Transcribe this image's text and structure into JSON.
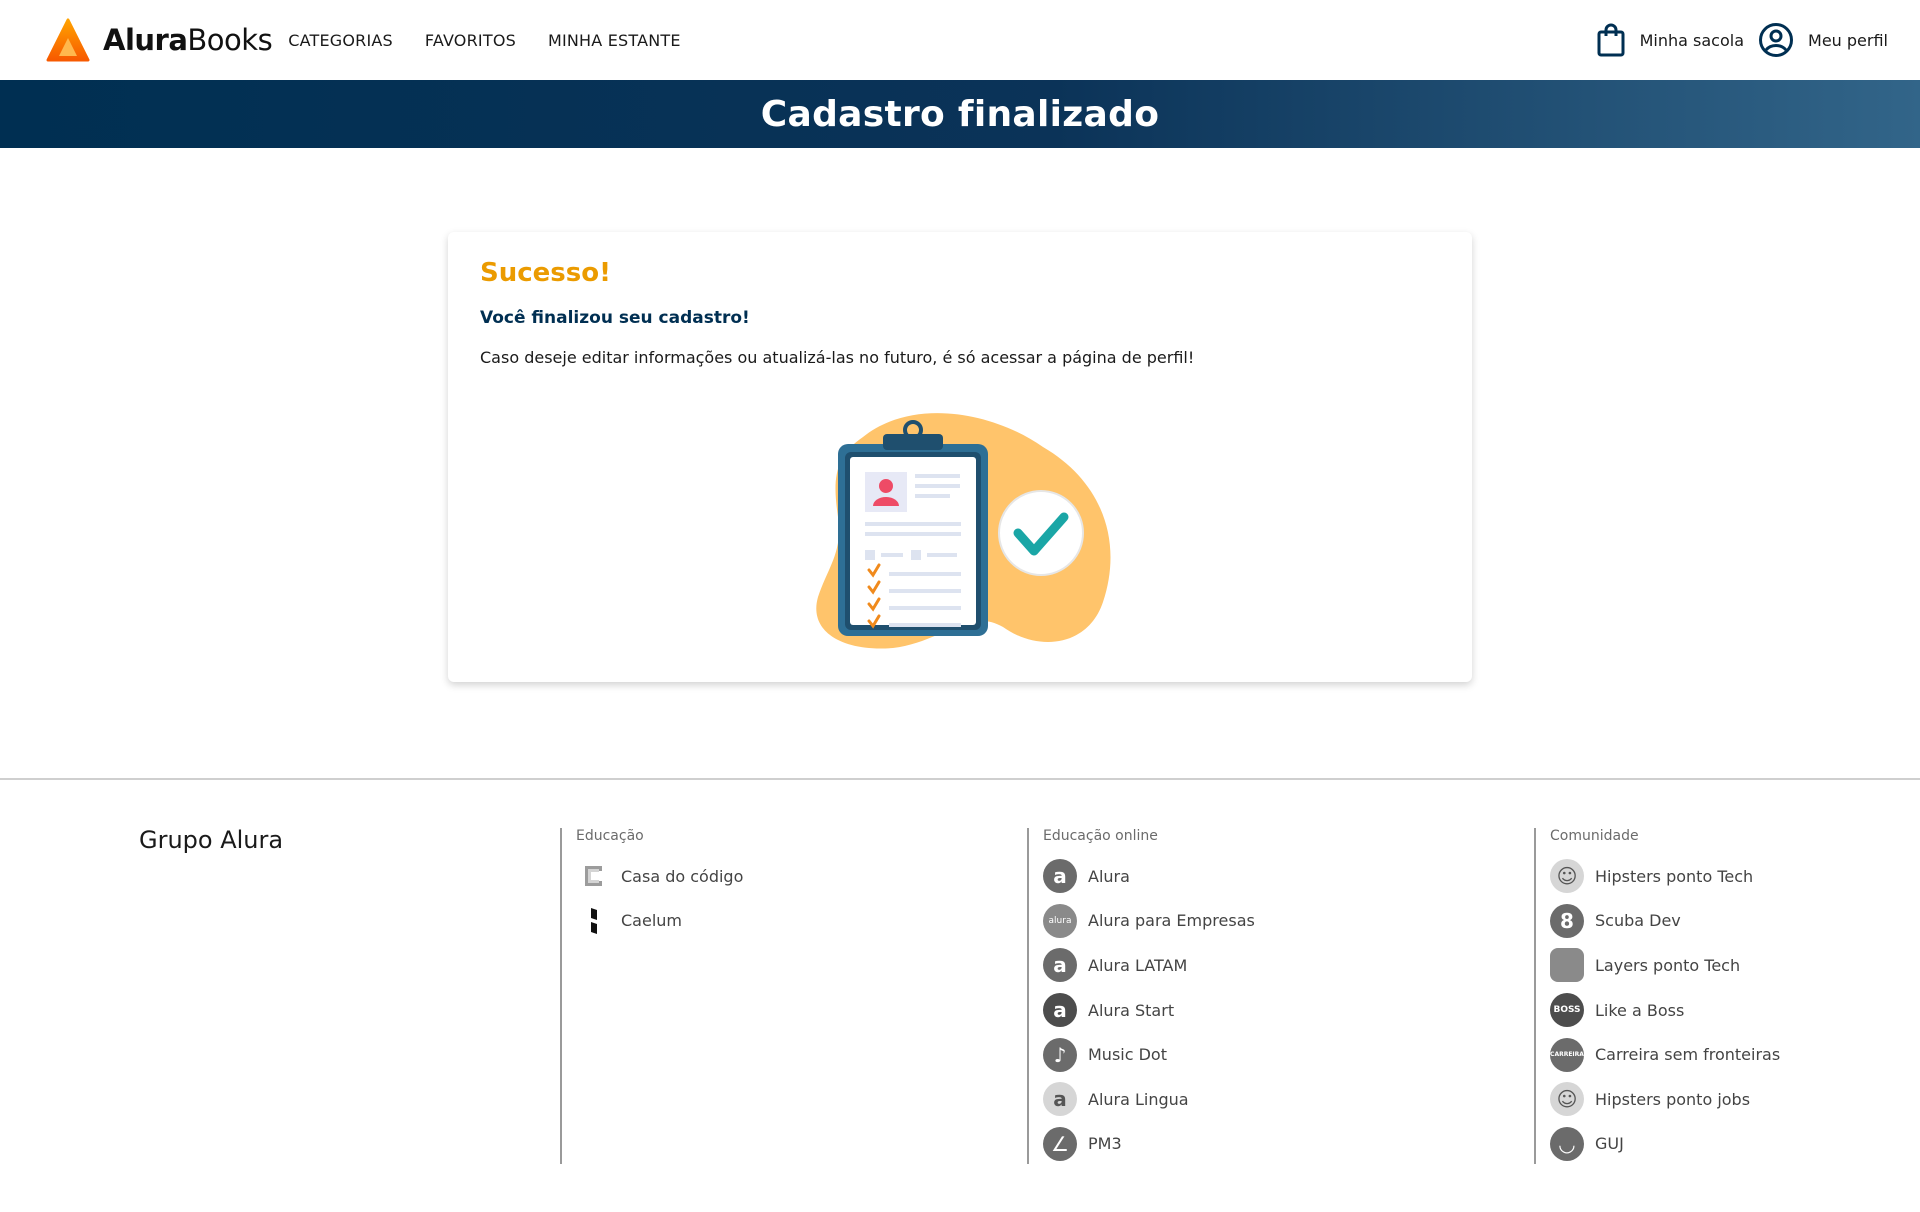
{
  "header": {
    "logo_bold": "Alura",
    "logo_light": "Books",
    "nav": [
      "CATEGORIAS",
      "FAVORITOS",
      "MINHA ESTANTE"
    ],
    "bag_label": "Minha sacola",
    "profile_label": "Meu perfil"
  },
  "banner": {
    "title": "Cadastro finalizado"
  },
  "card": {
    "heading": "Sucesso!",
    "subheading": "Você finalizou seu cadastro!",
    "message": "Caso deseje editar informações ou atualizá-las no futuro, é só acessar a página de perfil!"
  },
  "footer": {
    "brand": "Grupo Alura",
    "columns": [
      {
        "title": "Educação",
        "items": [
          {
            "label": "Casa do código",
            "icon": "casa-do-codigo-icon"
          },
          {
            "label": "Caelum",
            "icon": "caelum-icon"
          }
        ]
      },
      {
        "title": "Educação online",
        "items": [
          {
            "label": "Alura",
            "icon": "alura-icon"
          },
          {
            "label": "Alura para Empresas",
            "icon": "alura-empresas-icon"
          },
          {
            "label": "Alura LATAM",
            "icon": "alura-latam-icon"
          },
          {
            "label": "Alura Start",
            "icon": "alura-start-icon"
          },
          {
            "label": "Music Dot",
            "icon": "music-dot-icon"
          },
          {
            "label": "Alura Lingua",
            "icon": "alura-lingua-icon"
          },
          {
            "label": "PM3",
            "icon": "pm3-icon"
          }
        ]
      },
      {
        "title": "Comunidade",
        "items": [
          {
            "label": "Hipsters ponto Tech",
            "icon": "hipsters-tech-icon"
          },
          {
            "label": "Scuba Dev",
            "icon": "scuba-dev-icon"
          },
          {
            "label": "Layers ponto Tech",
            "icon": "layers-tech-icon"
          },
          {
            "label": "Like a Boss",
            "icon": "like-a-boss-icon"
          },
          {
            "label": "Carreira sem fronteiras",
            "icon": "carreira-icon"
          },
          {
            "label": "Hipsters ponto jobs",
            "icon": "hipsters-jobs-icon"
          },
          {
            "label": "GUJ",
            "icon": "guj-icon"
          }
        ]
      }
    ]
  },
  "colors": {
    "banner_dark": "#002f52",
    "banner_light": "#326589",
    "success": "#eb9b00",
    "navy": "#002f52",
    "logo_orange": "#f77b00"
  }
}
